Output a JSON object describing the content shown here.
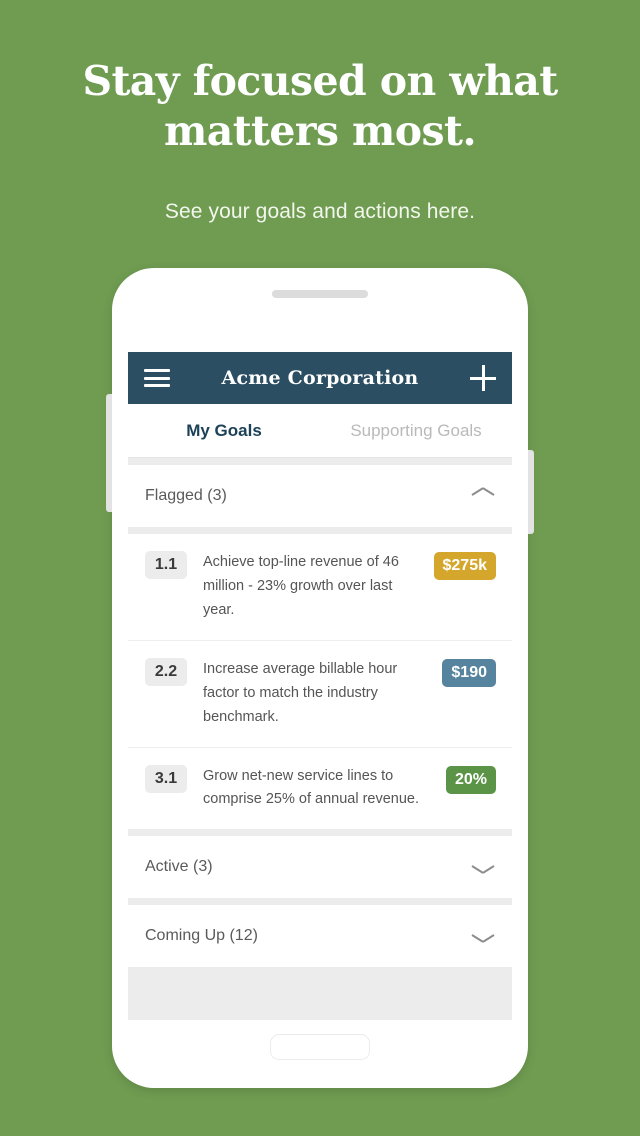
{
  "promo": {
    "headline": "Stay focused on what matters most.",
    "subtitle": "See your goals and actions here."
  },
  "colors": {
    "background_green": "#6f9c51",
    "header_navy": "#2b4e62",
    "badge_gold": "#d4a72c",
    "badge_blue": "#56839e",
    "badge_green": "#5b9447",
    "tab_active": "#1d4257",
    "tab_inactive": "#b9b9b9"
  },
  "app": {
    "header": {
      "menu_icon": "hamburger-icon",
      "title": "Acme Corporation",
      "add_icon": "plus-icon"
    },
    "tabs": [
      {
        "label": "My Goals",
        "active": true
      },
      {
        "label": "Supporting Goals",
        "active": false
      }
    ],
    "sections": [
      {
        "title": "Flagged (3)",
        "expanded": true,
        "chevron": "chevron-up-icon",
        "goals": [
          {
            "number": "1.1",
            "text": "Achieve top-line revenue of 46 million - 23% growth over last year.",
            "badge": "$275k",
            "badge_color": "#d4a72c"
          },
          {
            "number": "2.2",
            "text": "Increase average billable hour factor to match the industry benchmark.",
            "badge": "$190",
            "badge_color": "#56839e"
          },
          {
            "number": "3.1",
            "text": "Grow net-new service lines to comprise 25% of annual revenue.",
            "badge": "20%",
            "badge_color": "#5b9447"
          }
        ]
      },
      {
        "title": "Active (3)",
        "expanded": false,
        "chevron": "chevron-down-icon",
        "goals": []
      },
      {
        "title": "Coming Up (12)",
        "expanded": false,
        "chevron": "chevron-down-icon",
        "goals": []
      }
    ]
  }
}
